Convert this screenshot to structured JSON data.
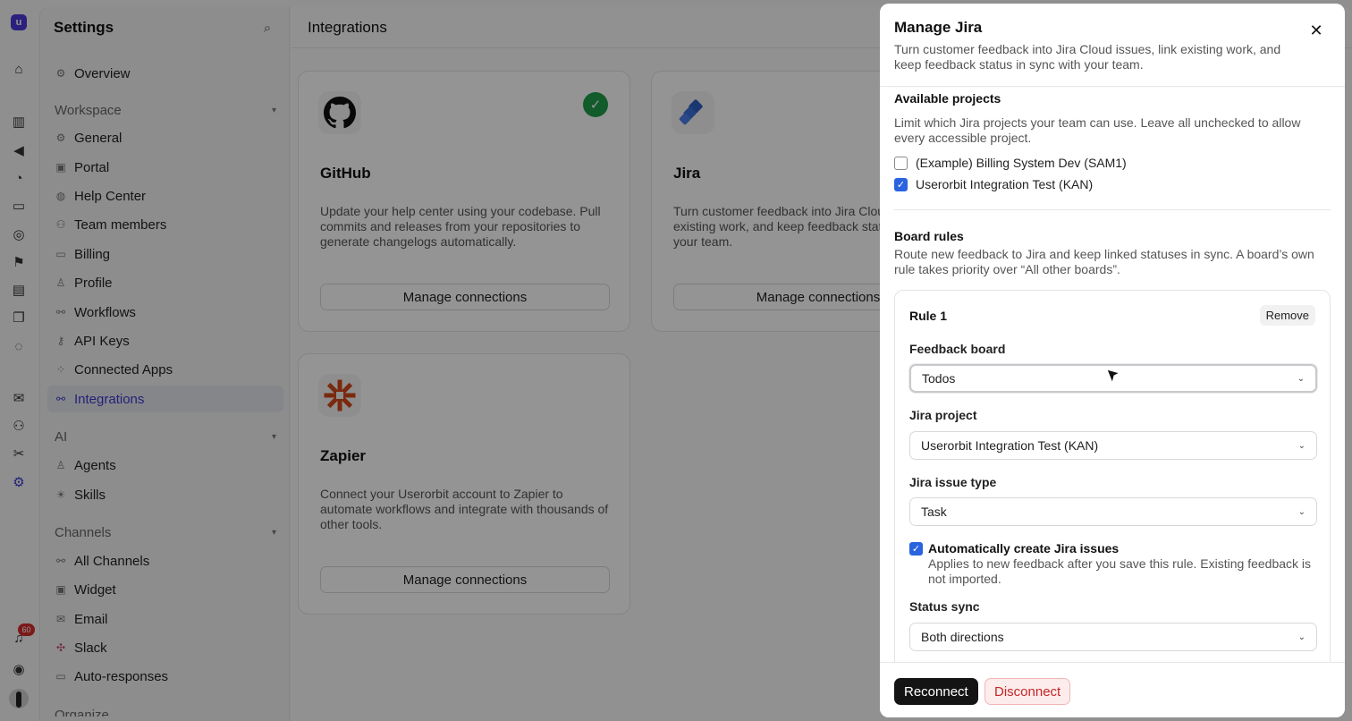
{
  "rail": {
    "logo_letter": "u",
    "badge_count": "60",
    "icons": [
      "home-icon",
      "chart-icon",
      "megaphone-icon",
      "chat-search-icon",
      "inbox-icon",
      "support-icon",
      "flag-icon",
      "card-icon",
      "book-icon",
      "message-icon",
      "mail-icon",
      "users-icon",
      "tools-icon",
      "gear-icon",
      "bell-icon",
      "help-icon"
    ]
  },
  "sidebar": {
    "title": "Settings",
    "overview": "Overview",
    "workspace_label": "Workspace",
    "workspace_items": [
      "General",
      "Portal",
      "Help Center",
      "Team members",
      "Billing",
      "Profile",
      "Workflows",
      "API Keys",
      "Connected Apps",
      "Integrations"
    ],
    "ai_label": "AI",
    "ai_items": [
      "Agents",
      "Skills"
    ],
    "channels_label": "Channels",
    "channels_items": [
      "All Channels",
      "Widget",
      "Email",
      "Slack",
      "Auto-responses"
    ],
    "cut_label": "Organize"
  },
  "main": {
    "title": "Integrations",
    "cards": [
      {
        "name": "GitHub",
        "desc": "Update your help center using your codebase. Pull commits and releases from your repositories to generate changelogs automatically.",
        "button": "Manage connections"
      },
      {
        "name": "Jira",
        "desc": "Turn customer feedback into Jira Cloud issues, link existing work, and keep feedback status in sync with your team.",
        "button": "Manage connections"
      },
      {
        "name": "Zapier",
        "desc": "Connect your Userorbit account to Zapier to automate workflows and integrate with thousands of other tools.",
        "button": "Manage connections"
      }
    ]
  },
  "drawer": {
    "title": "Manage Jira",
    "subtitle": "Turn customer feedback into Jira Cloud issues, link existing work, and keep feedback status in sync with your team.",
    "available_projects": {
      "heading": "Available projects",
      "desc": "Limit which Jira projects your team can use. Leave all unchecked to allow every accessible project.",
      "projects": [
        {
          "label": "(Example) Billing System Dev (SAM1)",
          "checked": false
        },
        {
          "label": "Userorbit Integration Test (KAN)",
          "checked": true
        }
      ]
    },
    "board_rules": {
      "heading": "Board rules",
      "desc": "Route new feedback to Jira and keep linked statuses in sync. A board’s own rule takes priority over “All other boards”."
    },
    "rule": {
      "title": "Rule 1",
      "remove": "Remove",
      "feedback_board_label": "Feedback board",
      "feedback_board_value": "Todos",
      "jira_project_label": "Jira project",
      "jira_project_value": "Userorbit Integration Test (KAN)",
      "issue_type_label": "Jira issue type",
      "issue_type_value": "Task",
      "auto_create_label": "Automatically create Jira issues",
      "auto_create_desc": "Applies to new feedback after you save this rule. Existing feedback is not imported.",
      "auto_create_checked": true,
      "status_sync_label": "Status sync",
      "status_sync_value": "Both directions"
    },
    "footer": {
      "reconnect": "Reconnect",
      "disconnect": "Disconnect"
    }
  },
  "colors": {
    "accent": "#3b3ad0",
    "checkbox": "#2a63e0",
    "success": "#1f9d4a",
    "danger": "#c42727"
  }
}
